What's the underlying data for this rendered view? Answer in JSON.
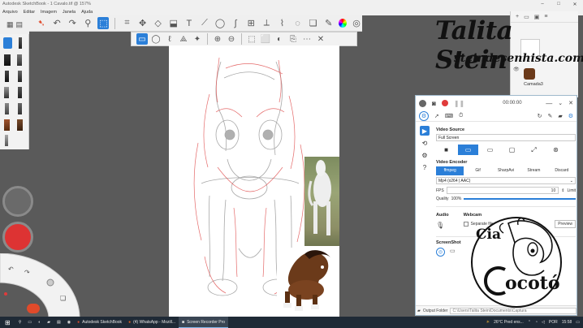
{
  "window": {
    "title": "Autodesk SketchBook - 1 Cavalo.tif @ 157%"
  },
  "menu": [
    "Arquivo",
    "Editar",
    "Imagem",
    "Janela",
    "Ajuda"
  ],
  "layers": {
    "layer_name": "Camada3"
  },
  "recorder": {
    "time": "00:00:00",
    "video_source_title": "Video Source",
    "source_value": "Full Screen",
    "encoder_title": "Video Encoder",
    "encoder_tabs": [
      "ffmpeg",
      "Gif",
      "SharpAvi",
      "Stream",
      "Discard"
    ],
    "codec_value": "Mp4 (x264 | AAC)",
    "fps_label": "FPS",
    "fps_value": "10",
    "limit_label": "Limit",
    "quality_label": "Quality",
    "quality_value": "100%",
    "quality_level": 1.0,
    "audio_title": "Audio",
    "webcam_title": "Webcam",
    "webcam_option": "Separate file",
    "preview_label": "Preview",
    "screenshot_title": "ScreenShot",
    "output_label": "Output Folder",
    "output_value": "C:\\Users\\Talita Stein\\Documents\\Captura"
  },
  "taskbar": {
    "items": [
      "Autodesk SketchBook",
      "(4) WhatsApp - Mozill...",
      "Screen Recorder Pro"
    ],
    "weather": "26°C Pred ens...",
    "lang": "POR",
    "time": "15:58"
  },
  "overlay": {
    "signature": "Talita Stein",
    "website": "steindesenhista.com",
    "logo_text": "Cia Cocotó"
  },
  "colors": {
    "accent": "#2b7fd8",
    "record_red": "#e03b3b",
    "sketch_red": "#e05050"
  }
}
